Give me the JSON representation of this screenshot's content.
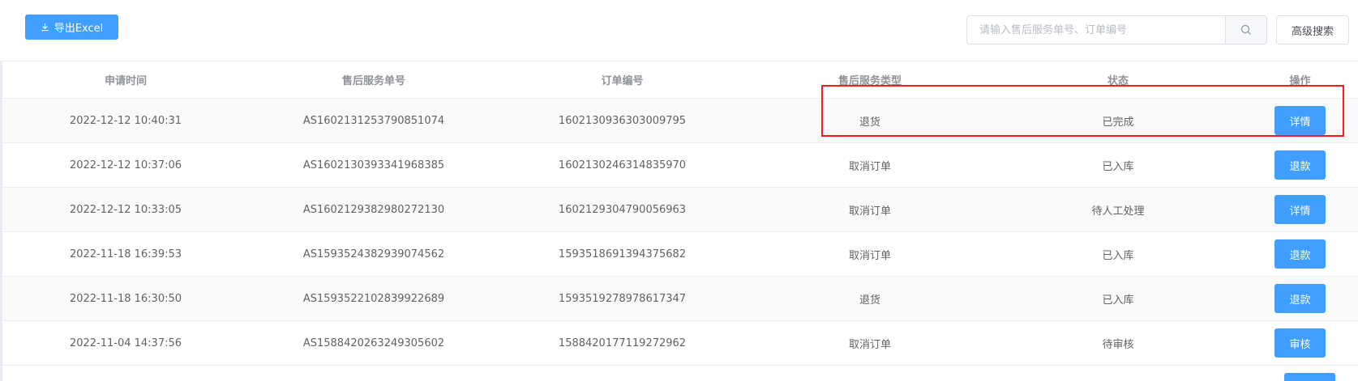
{
  "toolbar": {
    "export_label": "导出Excel",
    "search_placeholder": "请输入售后服务单号、订单编号",
    "search_value": "",
    "advanced_search_label": "高级搜索"
  },
  "table": {
    "headers": {
      "time": "申请时间",
      "as_no": "售后服务单号",
      "order_no": "订单编号",
      "type": "售后服务类型",
      "status": "状态",
      "action": "操作"
    },
    "rows": [
      {
        "time": "2022-12-12 10:40:31",
        "as_no": "AS1602131253790851074",
        "order_no": "1602130936303009795",
        "type": "退货",
        "status": "已完成",
        "action": "详情"
      },
      {
        "time": "2022-12-12 10:37:06",
        "as_no": "AS1602130393341968385",
        "order_no": "1602130246314835970",
        "type": "取消订单",
        "status": "已入库",
        "action": "退款"
      },
      {
        "time": "2022-12-12 10:33:05",
        "as_no": "AS1602129382980272130",
        "order_no": "1602129304790056963",
        "type": "取消订单",
        "status": "待人工处理",
        "action": "详情"
      },
      {
        "time": "2022-11-18 16:39:53",
        "as_no": "AS1593524382939074562",
        "order_no": "1593518691394375682",
        "type": "取消订单",
        "status": "已入库",
        "action": "退款"
      },
      {
        "time": "2022-11-18 16:30:50",
        "as_no": "AS1593522102839922689",
        "order_no": "1593519278978617347",
        "type": "退货",
        "status": "已入库",
        "action": "退款"
      },
      {
        "time": "2022-11-04 14:37:56",
        "as_no": "AS1588420263249305602",
        "order_no": "1588420177119272962",
        "type": "取消订单",
        "status": "待审核",
        "action": "审核"
      }
    ]
  },
  "colors": {
    "primary": "#409eff",
    "highlight": "#ff1a1a"
  }
}
